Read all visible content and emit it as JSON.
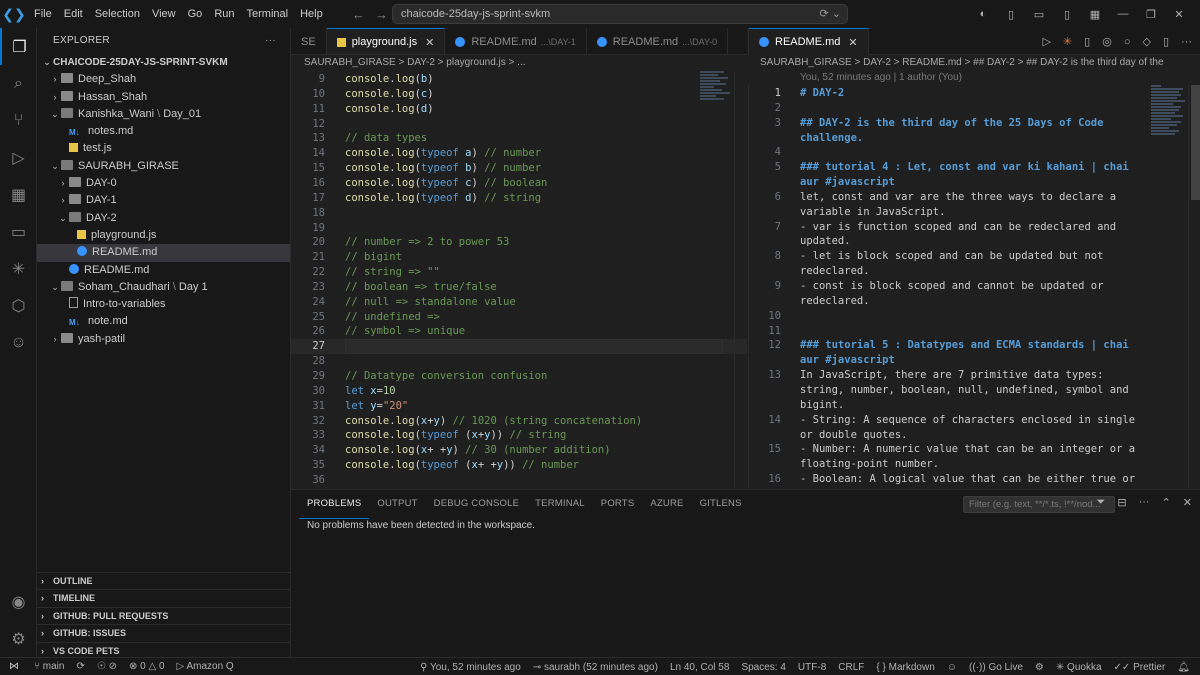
{
  "menu": [
    "File",
    "Edit",
    "Selection",
    "View",
    "Go",
    "Run",
    "Terminal",
    "Help"
  ],
  "command_center": "chaicode-25day-js-sprint-svkm",
  "explorer": {
    "title": "EXPLORER",
    "root": "CHAICODE-25DAY-JS-SPRINT-SVKM",
    "items": [
      {
        "label": "Deep_Shah",
        "type": "folder",
        "depth": 1,
        "open": false
      },
      {
        "label": "Hassan_Shah",
        "type": "folder",
        "depth": 1,
        "open": false
      },
      {
        "label": "Kanishka_Wani",
        "sub": "Day_01",
        "type": "folder",
        "depth": 1,
        "open": true
      },
      {
        "label": "notes.md",
        "type": "md",
        "depth": 2
      },
      {
        "label": "test.js",
        "type": "js",
        "depth": 2
      },
      {
        "label": "SAURABH_GIRASE",
        "type": "folder",
        "depth": 1,
        "open": true
      },
      {
        "label": "DAY-0",
        "type": "folder",
        "depth": 2,
        "open": false
      },
      {
        "label": "DAY-1",
        "type": "folder",
        "depth": 2,
        "open": false
      },
      {
        "label": "DAY-2",
        "type": "folder",
        "depth": 2,
        "open": true
      },
      {
        "label": "playground.js",
        "type": "js",
        "depth": 3
      },
      {
        "label": "README.md",
        "type": "info",
        "depth": 3,
        "selected": true
      },
      {
        "label": "README.md",
        "type": "info",
        "depth": 2
      },
      {
        "label": "Soham_Chaudhari",
        "sub": "Day 1",
        "type": "folder",
        "depth": 1,
        "open": true
      },
      {
        "label": "Intro-to-variables",
        "type": "doc",
        "depth": 2
      },
      {
        "label": "note.md",
        "type": "md",
        "depth": 2
      },
      {
        "label": "yash-patil",
        "type": "folder",
        "depth": 1,
        "open": false
      }
    ],
    "sections": [
      "OUTLINE",
      "TIMELINE",
      "GITHUB: PULL REQUESTS",
      "GITHUB: ISSUES",
      "VS CODE PETS"
    ]
  },
  "editor1": {
    "tabs": [
      {
        "label": "SE",
        "active": false
      },
      {
        "label": "playground.js",
        "active": true
      },
      {
        "label": "README.md",
        "sub": "...\\DAY-1",
        "active": false
      },
      {
        "label": "README.md",
        "sub": "...\\DAY-0",
        "active": false
      }
    ],
    "breadcrumb": "SAURABH_GIRASE  >  DAY-2  >  playground.js  >  ...",
    "current_line": 27
  },
  "editor2": {
    "tab": "README.md",
    "breadcrumb": "SAURABH_GIRASE  >  DAY-2  >  README.md  >  ## DAY-2  >  ## DAY-2 is the third day of the",
    "blame": "You, 52 minutes ago | 1 author (You)",
    "lines": [
      {
        "n": 1,
        "text": "# DAY-2",
        "heading": true
      },
      {
        "n": 2,
        "text": ""
      },
      {
        "n": 3,
        "text": "## DAY-2 is the third day of the 25 Days of Code challenge.",
        "heading": true
      },
      {
        "n": 4,
        "text": ""
      },
      {
        "n": 5,
        "text": "### tutorial 4 : Let, const and var ki kahani | chai aur #javascript",
        "heading": true
      },
      {
        "n": 6,
        "text": "let, const and var are the three ways to declare a variable in JavaScript."
      },
      {
        "n": 7,
        "text": "- var is function scoped and can be redeclared and updated."
      },
      {
        "n": 8,
        "text": "- let is block scoped and can be updated but not redeclared."
      },
      {
        "n": 9,
        "text": "- const is block scoped and cannot be updated or redeclared."
      },
      {
        "n": 10,
        "text": ""
      },
      {
        "n": 11,
        "text": ""
      },
      {
        "n": 12,
        "text": "### tutorial 5 : Datatypes and ECMA standards | chai aur #javascript",
        "heading": true
      },
      {
        "n": 13,
        "text": "In JavaScript, there are 7 primitive data types: string, number, boolean, null, undefined, symbol and bigint."
      },
      {
        "n": 14,
        "text": "- String: A sequence of characters enclosed in single or double quotes."
      },
      {
        "n": 15,
        "text": "- Number: A numeric value that can be an integer or a floating-point number."
      },
      {
        "n": 16,
        "text": "- Boolean: A logical value that can be either true or false."
      }
    ]
  },
  "panel": {
    "tabs": [
      "PROBLEMS",
      "OUTPUT",
      "DEBUG CONSOLE",
      "TERMINAL",
      "PORTS",
      "AZURE",
      "GITLENS"
    ],
    "filter_placeholder": "Filter (e.g. text, **/*.ts, !**/nod...",
    "message": "No problems have been detected in the workspace."
  },
  "status": {
    "branch": "main",
    "errors": "0",
    "warnings": "0",
    "amazon_q": "Amazon Q",
    "blame": "You, 52 minutes ago",
    "author": "saurabh (52 minutes ago)",
    "position": "Ln 40, Col 58",
    "spaces": "Spaces: 4",
    "encoding": "UTF-8",
    "eol": "CRLF",
    "language": "Markdown",
    "golive": "Go Live",
    "quokka": "Quokka",
    "prettier": "Prettier"
  }
}
